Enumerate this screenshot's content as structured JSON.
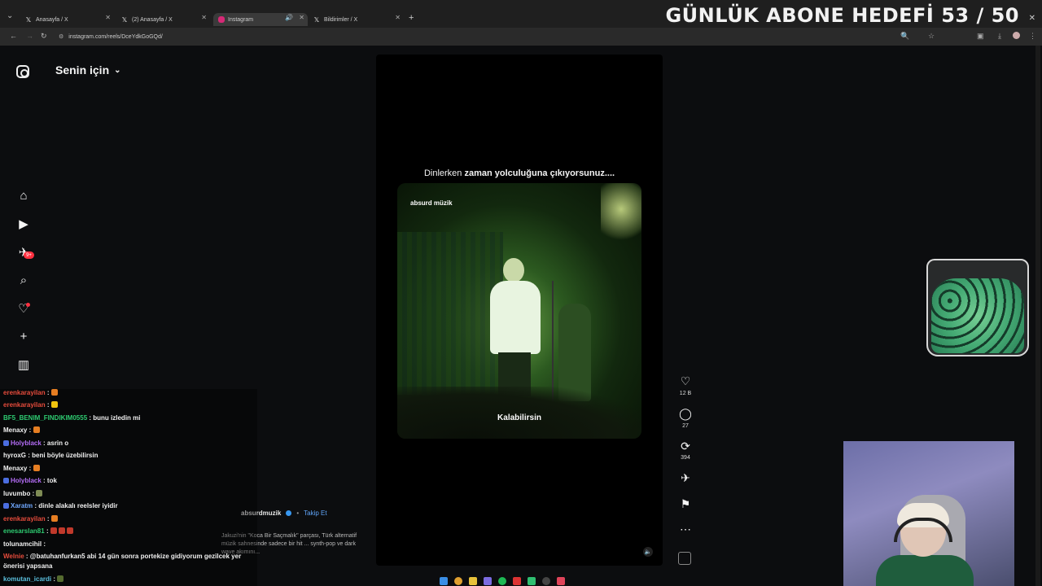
{
  "browser": {
    "tabs": [
      {
        "label": "Anasayfa / X",
        "icon": "x-icon"
      },
      {
        "label": "(2) Anasayfa / X",
        "icon": "x-icon"
      },
      {
        "label": "Instagram",
        "icon": "instagram-icon",
        "active": true
      },
      {
        "label": "Bildirimler / X",
        "icon": "x-icon"
      }
    ],
    "url": "instagram.com/reels/DceYdkGoGQd/"
  },
  "overlay": {
    "subscriber_goal": "GÜNLÜK ABONE HEDEFİ 53 / 50"
  },
  "instagram": {
    "feed_title": "Senin için",
    "notification_badge": "9+",
    "reel": {
      "caption_normal": "Dinlerken ",
      "caption_bold": "zaman yolculuğuna çıkıyorsunuz....",
      "brand": "absurd müzik",
      "subtitle": "Kalabilirsin",
      "author": "absurdmuzik",
      "follow": "Takip Et",
      "separator": "•",
      "description": "Jakuzi'nin \"Koca Bir Saçmalık\" parçası, Türk alternatif müzik sahnesinde sadece bir hit ... synth-pop ve dark wave akımını...",
      "likes": "12 B",
      "comments": "27",
      "reposts": "394"
    }
  },
  "chat": [
    {
      "user": "erenkarayilan",
      "color": "#e74c3c",
      "text": ":"
    },
    {
      "user": "erenkarayilan",
      "color": "#e74c3c",
      "text": ":"
    },
    {
      "user": "BF5_BENIM_FINDIKIM0555",
      "color": "#2ecc71",
      "text": ": bunu izledin mi"
    },
    {
      "user": "Menaxy",
      "color": "#f0f0f0",
      "text": ":"
    },
    {
      "user": "Holyblack",
      "color": "#b36cf5",
      "text": ": asrin o"
    },
    {
      "user": "hyroxG",
      "color": "#f0f0f0",
      "text": ": beni böyle üzebilirsin"
    },
    {
      "user": "Menaxy",
      "color": "#f0f0f0",
      "text": ":"
    },
    {
      "user": "Holyblack",
      "color": "#b36cf5",
      "text": ": tok"
    },
    {
      "user": "luvumbo",
      "color": "#f0f0f0",
      "text": ":"
    },
    {
      "user": "Xaratm",
      "color": "#6fa8ff",
      "text": ": dinle alakalı reelsler iyidir"
    },
    {
      "user": "erenkarayilan",
      "color": "#e74c3c",
      "text": ":"
    },
    {
      "user": "enesarslan81",
      "color": "#2ecc71",
      "text": ":"
    },
    {
      "user": "tolunamcihil",
      "color": "#f0f0f0",
      "text": ":"
    },
    {
      "user": "Welnie",
      "color": "#e74c3c",
      "text": ": @batuhanfurkan5 abi 14 gün sonra portekize gidiyorum gezilcek yer"
    },
    {
      "user": "",
      "color": "#f0f0f0",
      "text": "önerisi yapsana"
    },
    {
      "user": "komutan_icardi",
      "color": "#5bc0de",
      "text": ":"
    }
  ]
}
